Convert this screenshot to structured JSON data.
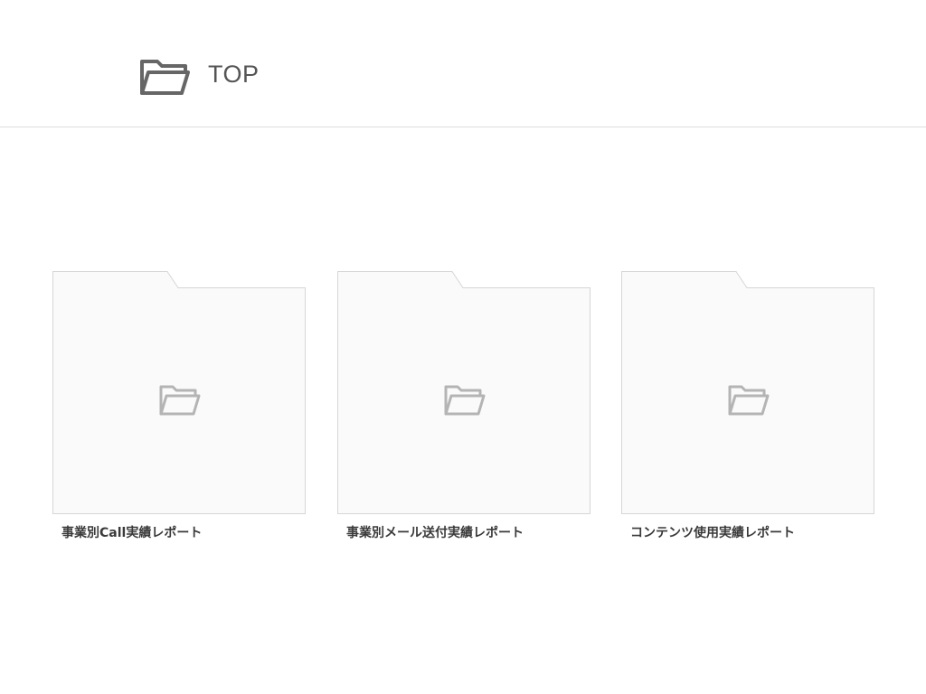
{
  "header": {
    "title": "TOP",
    "icon": "folder-open-icon"
  },
  "folders": [
    {
      "label": "事業別Call実績レポート",
      "icon": "folder-open-icon"
    },
    {
      "label": "事業別メール送付実績レポート",
      "icon": "folder-open-icon"
    },
    {
      "label": "コンテンツ使用実績レポート",
      "icon": "folder-open-icon"
    }
  ],
  "colors": {
    "icon_dark": "#666666",
    "icon_light": "#b4b4b4",
    "card_fill": "#fafafa",
    "card_border": "#d6d6d6",
    "divider": "#dcdcdc"
  }
}
